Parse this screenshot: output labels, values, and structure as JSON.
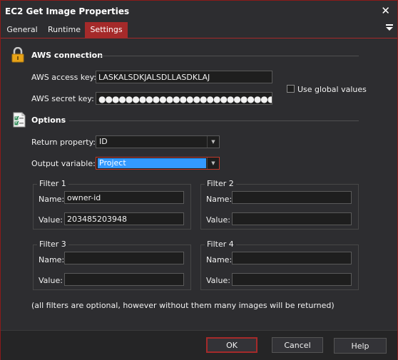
{
  "window": {
    "title": "EC2 Get Image Properties"
  },
  "tabs": [
    {
      "label": "General"
    },
    {
      "label": "Runtime"
    },
    {
      "label": "Settings"
    }
  ],
  "aws": {
    "section_title": "AWS connection",
    "access_key_label": "AWS access key:",
    "access_key_value": "LASKALSDKJALSDLLASDKLAJ",
    "secret_key_label": "AWS secret key:",
    "secret_key_value": "●●●●●●●●●●●●●●●●●●●●●●●●●●●●●●●●●●●●●●●",
    "global_label": "Use global values"
  },
  "options": {
    "section_title": "Options",
    "return_label": "Return property:",
    "return_value": "ID",
    "output_label": "Output variable:",
    "output_value": "Project"
  },
  "filters": [
    {
      "title": "Filter 1",
      "name_label": "Name:",
      "name_value": "owner-id",
      "value_label": "Value:",
      "value_value": "203485203948"
    },
    {
      "title": "Filter 2",
      "name_label": "Name:",
      "name_value": "",
      "value_label": "Value:",
      "value_value": ""
    },
    {
      "title": "Filter 3",
      "name_label": "Name:",
      "name_value": "",
      "value_label": "Value:",
      "value_value": ""
    },
    {
      "title": "Filter 4",
      "name_label": "Name:",
      "name_value": "",
      "value_label": "Value:",
      "value_value": ""
    }
  ],
  "note": "(all filters are optional, however without them many images will be returned)",
  "buttons": {
    "ok": "OK",
    "cancel": "Cancel",
    "help": "Help"
  },
  "icons": {
    "close": "close-icon",
    "menu": "menu-icon",
    "lock": "lock-icon",
    "checklist": "checklist-icon",
    "dropdown": "chevron-down-icon"
  },
  "colors": {
    "accent": "#a52a2a",
    "background": "#2d2d30",
    "selection": "#3399ff"
  }
}
